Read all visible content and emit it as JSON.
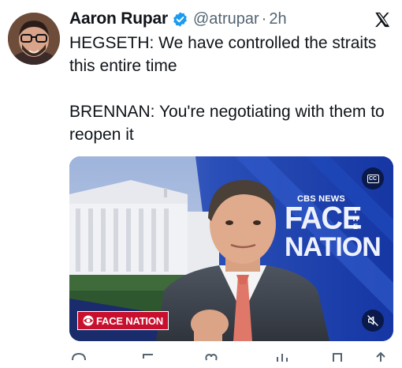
{
  "tweet": {
    "display_name": "Aaron Rupar",
    "handle": "@atrupar",
    "separator": "·",
    "time": "2h",
    "text_line1": "HEGSETH: We have controlled the straits this entire time",
    "text_line2": "BRENNAN: You're negotiating with them to reopen it"
  },
  "media": {
    "network_label": "CBS NEWS",
    "show_word1": "FACE",
    "show_the": "THE",
    "show_word2": "NATION",
    "lower_third_logo": "FACE NATION",
    "cc_label": "CC"
  },
  "icons": {
    "verified": "verified-badge-icon",
    "brand": "x-logo-icon",
    "captions": "closed-captions-icon",
    "mute": "muted-speaker-icon"
  },
  "colors": {
    "verified_blue": "#1d9bf0",
    "text_primary": "#0f1419",
    "text_secondary": "#536471",
    "cbs_red": "#c8102e",
    "studio_blue": "#1d3fa8"
  }
}
